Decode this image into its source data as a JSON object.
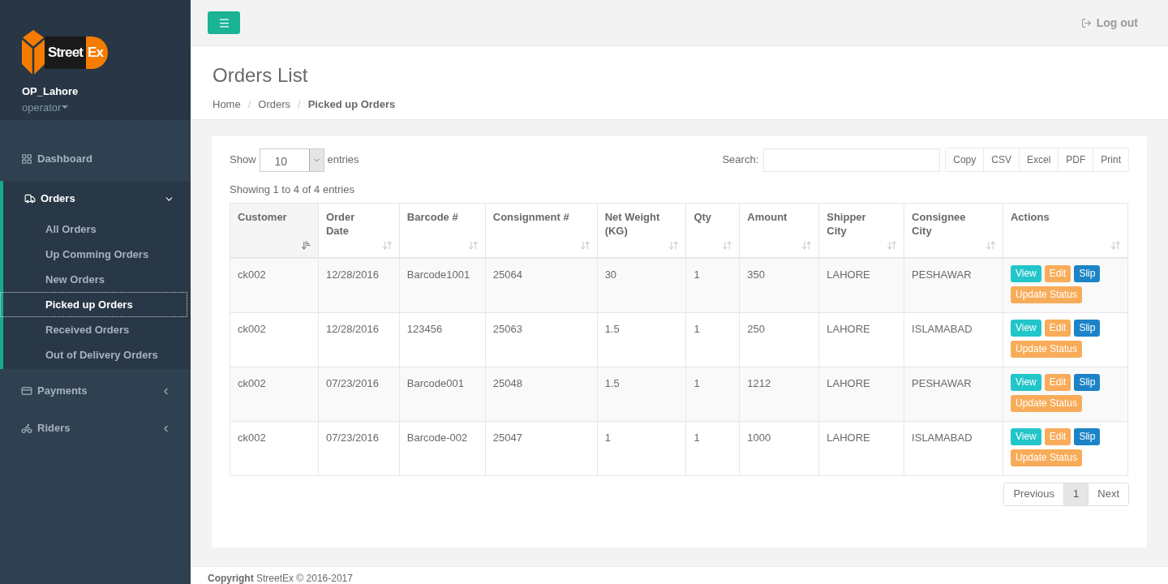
{
  "sidebar": {
    "logo": {
      "word": "Street",
      "suffix": "Ex"
    },
    "user": {
      "name": "OP_Lahore",
      "role": "operator"
    },
    "items": [
      {
        "label": "Dashboard",
        "expanded": false,
        "has_caret": false
      },
      {
        "label": "Orders",
        "expanded": true,
        "has_caret": true,
        "children": [
          {
            "label": "All Orders",
            "selected": false
          },
          {
            "label": "Up Comming Orders",
            "selected": false
          },
          {
            "label": "New Orders",
            "selected": false
          },
          {
            "label": "Picked up Orders",
            "selected": true
          },
          {
            "label": "Received Orders",
            "selected": false
          },
          {
            "label": "Out of Delivery Orders",
            "selected": false
          }
        ]
      },
      {
        "label": "Payments",
        "expanded": false,
        "has_caret": true
      },
      {
        "label": "Riders",
        "expanded": false,
        "has_caret": true
      }
    ]
  },
  "topbar": {
    "logout": "Log out"
  },
  "page": {
    "title": "Orders List",
    "separator": "/",
    "breadcrumb": [
      {
        "label": "Home",
        "current": false
      },
      {
        "label": "Orders",
        "current": false
      },
      {
        "label": "Picked up Orders",
        "current": true
      }
    ]
  },
  "table_controls": {
    "show_label": "Show",
    "page_size": "10",
    "entries_label": "entries",
    "search_label": "Search:",
    "export_buttons": [
      "Copy",
      "CSV",
      "Excel",
      "PDF",
      "Print"
    ],
    "info": "Showing 1 to 4 of 4 entries"
  },
  "table": {
    "columns": [
      {
        "label": "Customer",
        "sorted": true
      },
      {
        "label": "Order Date",
        "sorted": false
      },
      {
        "label": "Barcode #",
        "sorted": false
      },
      {
        "label": "Consignment #",
        "sorted": false
      },
      {
        "label": "Net Weight (KG)",
        "sorted": false
      },
      {
        "label": "Qty",
        "sorted": false
      },
      {
        "label": "Amount",
        "sorted": false
      },
      {
        "label": "Shipper City",
        "sorted": false
      },
      {
        "label": "Consignee City",
        "sorted": false
      },
      {
        "label": "Actions",
        "sorted": false
      }
    ],
    "rows": [
      {
        "cells": [
          "ck002",
          "12/28/2016",
          "Barcode1001",
          "25064",
          "30",
          "1",
          "350",
          "LAHORE",
          "PESHAWAR"
        ],
        "actions": [
          {
            "label": "View",
            "kind": "info"
          },
          {
            "label": "Edit",
            "kind": "warning"
          },
          {
            "label": "Slip",
            "kind": "primary"
          },
          {
            "label": "Update Status",
            "kind": "warning"
          }
        ]
      },
      {
        "cells": [
          "ck002",
          "12/28/2016",
          "123456",
          "25063",
          "1.5",
          "1",
          "250",
          "LAHORE",
          "ISLAMABAD"
        ],
        "actions": [
          {
            "label": "View",
            "kind": "info"
          },
          {
            "label": "Edit",
            "kind": "warning"
          },
          {
            "label": "Slip",
            "kind": "primary"
          },
          {
            "label": "Update Status",
            "kind": "warning"
          }
        ]
      },
      {
        "cells": [
          "ck002",
          "07/23/2016",
          "Barcode001",
          "25048",
          "1.5",
          "1",
          "1212",
          "LAHORE",
          "PESHAWAR"
        ],
        "actions": [
          {
            "label": "View",
            "kind": "info"
          },
          {
            "label": "Edit",
            "kind": "warning"
          },
          {
            "label": "Slip",
            "kind": "primary"
          },
          {
            "label": "Update Status",
            "kind": "warning"
          }
        ]
      },
      {
        "cells": [
          "ck002",
          "07/23/2016",
          "Barcode-002",
          "25047",
          "1",
          "1",
          "1000",
          "LAHORE",
          "ISLAMABAD"
        ],
        "actions": [
          {
            "label": "View",
            "kind": "info"
          },
          {
            "label": "Edit",
            "kind": "warning"
          },
          {
            "label": "Slip",
            "kind": "primary"
          },
          {
            "label": "Update Status",
            "kind": "warning"
          }
        ]
      }
    ]
  },
  "pagination": [
    {
      "label": "Previous",
      "selected": false
    },
    {
      "label": "1",
      "selected": true
    },
    {
      "label": "Next",
      "selected": false
    }
  ],
  "footer": {
    "text": "**Copyright** StreetEx © 2016-2017"
  }
}
